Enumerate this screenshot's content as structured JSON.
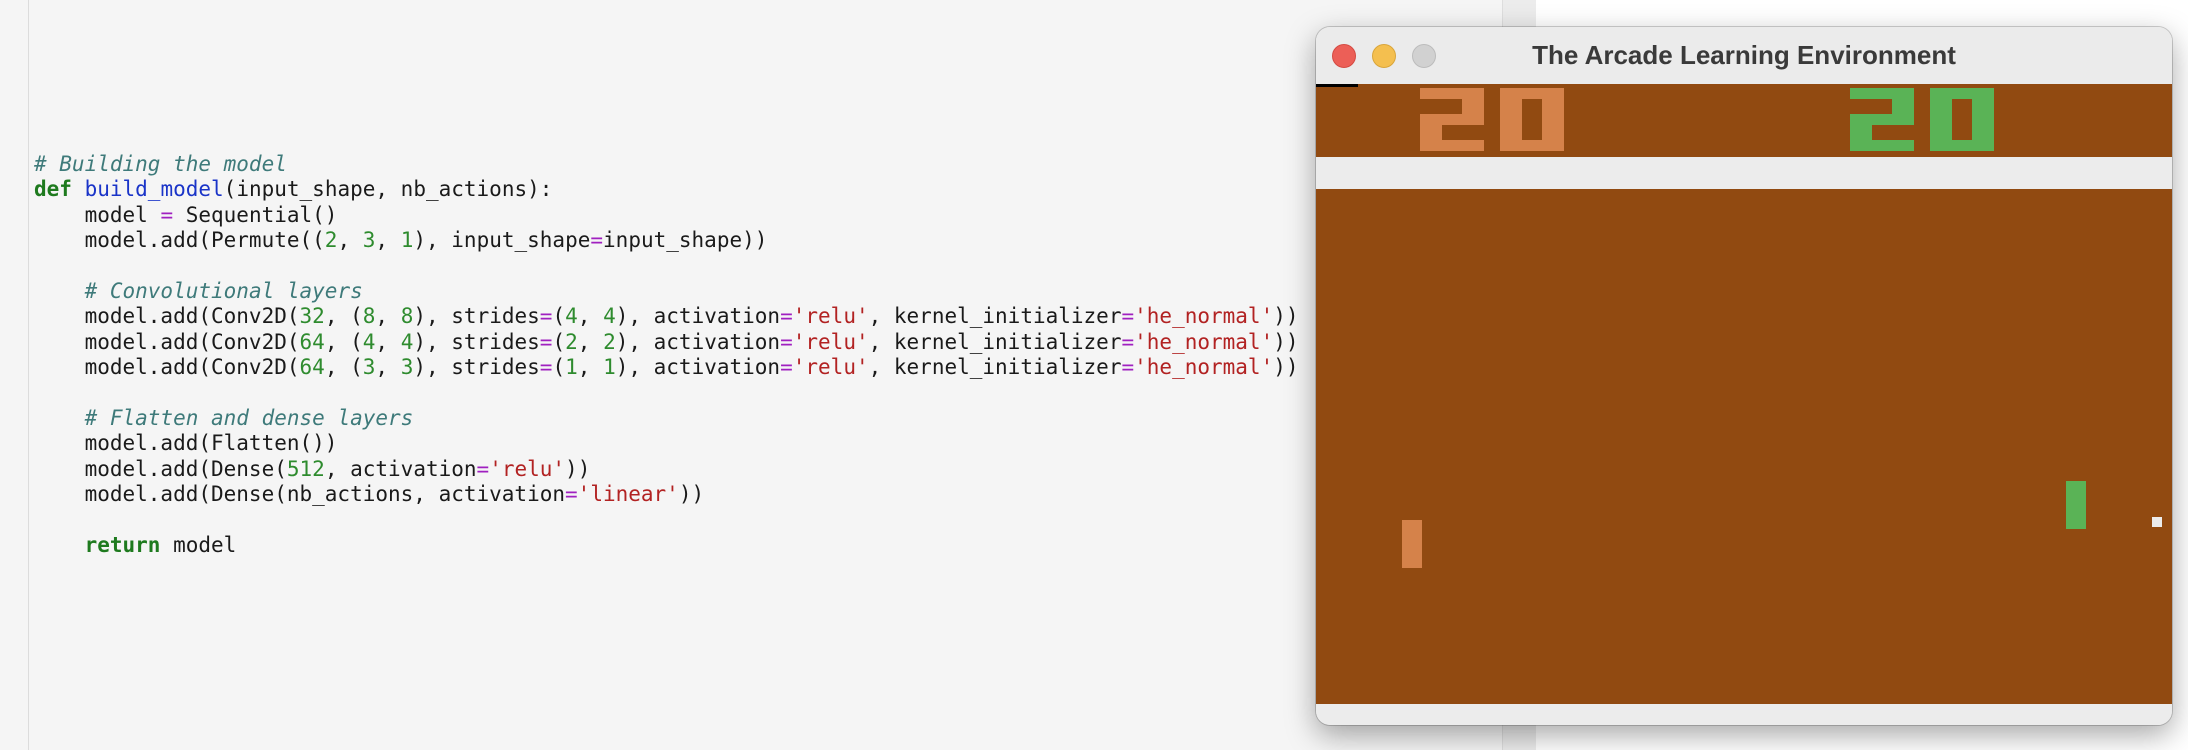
{
  "editor": {
    "lines": [
      [
        {
          "t": "# Building the model",
          "c": "comment"
        }
      ],
      [
        {
          "t": "def",
          "c": "keyword"
        },
        {
          "t": " ",
          "c": "plain"
        },
        {
          "t": "build_model",
          "c": "funcname"
        },
        {
          "t": "(input_shape, nb_actions):",
          "c": "plain"
        }
      ],
      [
        {
          "t": "    model ",
          "c": "plain"
        },
        {
          "t": "=",
          "c": "op"
        },
        {
          "t": " Sequential()",
          "c": "plain"
        }
      ],
      [
        {
          "t": "    model.add(Permute((",
          "c": "plain"
        },
        {
          "t": "2",
          "c": "number"
        },
        {
          "t": ", ",
          "c": "plain"
        },
        {
          "t": "3",
          "c": "number"
        },
        {
          "t": ", ",
          "c": "plain"
        },
        {
          "t": "1",
          "c": "number"
        },
        {
          "t": "), input_shape",
          "c": "plain"
        },
        {
          "t": "=",
          "c": "op"
        },
        {
          "t": "input_shape))",
          "c": "plain"
        }
      ],
      [],
      [
        {
          "t": "    ",
          "c": "plain"
        },
        {
          "t": "# Convolutional layers",
          "c": "comment"
        }
      ],
      [
        {
          "t": "    model.add(Conv2D(",
          "c": "plain"
        },
        {
          "t": "32",
          "c": "number"
        },
        {
          "t": ", (",
          "c": "plain"
        },
        {
          "t": "8",
          "c": "number"
        },
        {
          "t": ", ",
          "c": "plain"
        },
        {
          "t": "8",
          "c": "number"
        },
        {
          "t": "), strides",
          "c": "plain"
        },
        {
          "t": "=",
          "c": "op"
        },
        {
          "t": "(",
          "c": "plain"
        },
        {
          "t": "4",
          "c": "number"
        },
        {
          "t": ", ",
          "c": "plain"
        },
        {
          "t": "4",
          "c": "number"
        },
        {
          "t": "), activation",
          "c": "plain"
        },
        {
          "t": "=",
          "c": "op"
        },
        {
          "t": "'relu'",
          "c": "string"
        },
        {
          "t": ", kernel_initializer",
          "c": "plain"
        },
        {
          "t": "=",
          "c": "op"
        },
        {
          "t": "'he_normal'",
          "c": "string"
        },
        {
          "t": "))",
          "c": "plain"
        }
      ],
      [
        {
          "t": "    model.add(Conv2D(",
          "c": "plain"
        },
        {
          "t": "64",
          "c": "number"
        },
        {
          "t": ", (",
          "c": "plain"
        },
        {
          "t": "4",
          "c": "number"
        },
        {
          "t": ", ",
          "c": "plain"
        },
        {
          "t": "4",
          "c": "number"
        },
        {
          "t": "), strides",
          "c": "plain"
        },
        {
          "t": "=",
          "c": "op"
        },
        {
          "t": "(",
          "c": "plain"
        },
        {
          "t": "2",
          "c": "number"
        },
        {
          "t": ", ",
          "c": "plain"
        },
        {
          "t": "2",
          "c": "number"
        },
        {
          "t": "), activation",
          "c": "plain"
        },
        {
          "t": "=",
          "c": "op"
        },
        {
          "t": "'relu'",
          "c": "string"
        },
        {
          "t": ", kernel_initializer",
          "c": "plain"
        },
        {
          "t": "=",
          "c": "op"
        },
        {
          "t": "'he_normal'",
          "c": "string"
        },
        {
          "t": "))",
          "c": "plain"
        }
      ],
      [
        {
          "t": "    model.add(Conv2D(",
          "c": "plain"
        },
        {
          "t": "64",
          "c": "number"
        },
        {
          "t": ", (",
          "c": "plain"
        },
        {
          "t": "3",
          "c": "number"
        },
        {
          "t": ", ",
          "c": "plain"
        },
        {
          "t": "3",
          "c": "number"
        },
        {
          "t": "), strides",
          "c": "plain"
        },
        {
          "t": "=",
          "c": "op"
        },
        {
          "t": "(",
          "c": "plain"
        },
        {
          "t": "1",
          "c": "number"
        },
        {
          "t": ", ",
          "c": "plain"
        },
        {
          "t": "1",
          "c": "number"
        },
        {
          "t": "), activation",
          "c": "plain"
        },
        {
          "t": "=",
          "c": "op"
        },
        {
          "t": "'relu'",
          "c": "string"
        },
        {
          "t": ", kernel_initializer",
          "c": "plain"
        },
        {
          "t": "=",
          "c": "op"
        },
        {
          "t": "'he_normal'",
          "c": "string"
        },
        {
          "t": "))",
          "c": "plain"
        }
      ],
      [],
      [
        {
          "t": "    ",
          "c": "plain"
        },
        {
          "t": "# Flatten and dense layers",
          "c": "comment"
        }
      ],
      [
        {
          "t": "    model.add(Flatten())",
          "c": "plain"
        }
      ],
      [
        {
          "t": "    model.add(Dense(",
          "c": "plain"
        },
        {
          "t": "512",
          "c": "number"
        },
        {
          "t": ", activation",
          "c": "plain"
        },
        {
          "t": "=",
          "c": "op"
        },
        {
          "t": "'relu'",
          "c": "string"
        },
        {
          "t": "))",
          "c": "plain"
        }
      ],
      [
        {
          "t": "    model.add(Dense(nb_actions, activation",
          "c": "plain"
        },
        {
          "t": "=",
          "c": "op"
        },
        {
          "t": "'linear'",
          "c": "string"
        },
        {
          "t": "))",
          "c": "plain"
        }
      ],
      [],
      [
        {
          "t": "    ",
          "c": "plain"
        },
        {
          "t": "return",
          "c": "keyword"
        },
        {
          "t": " model",
          "c": "plain"
        }
      ]
    ]
  },
  "window": {
    "title": "The Arcade Learning Environment",
    "buttons": [
      "close",
      "minimize",
      "zoom"
    ]
  },
  "game": {
    "name": "Pong",
    "scores": {
      "left": "20",
      "right": "20"
    },
    "colors": {
      "field": "#914a11",
      "band": "#ececec",
      "left_player": "#d5824a",
      "right_player": "#5ab356",
      "ball": "#ececec",
      "marker": "#000000"
    }
  }
}
